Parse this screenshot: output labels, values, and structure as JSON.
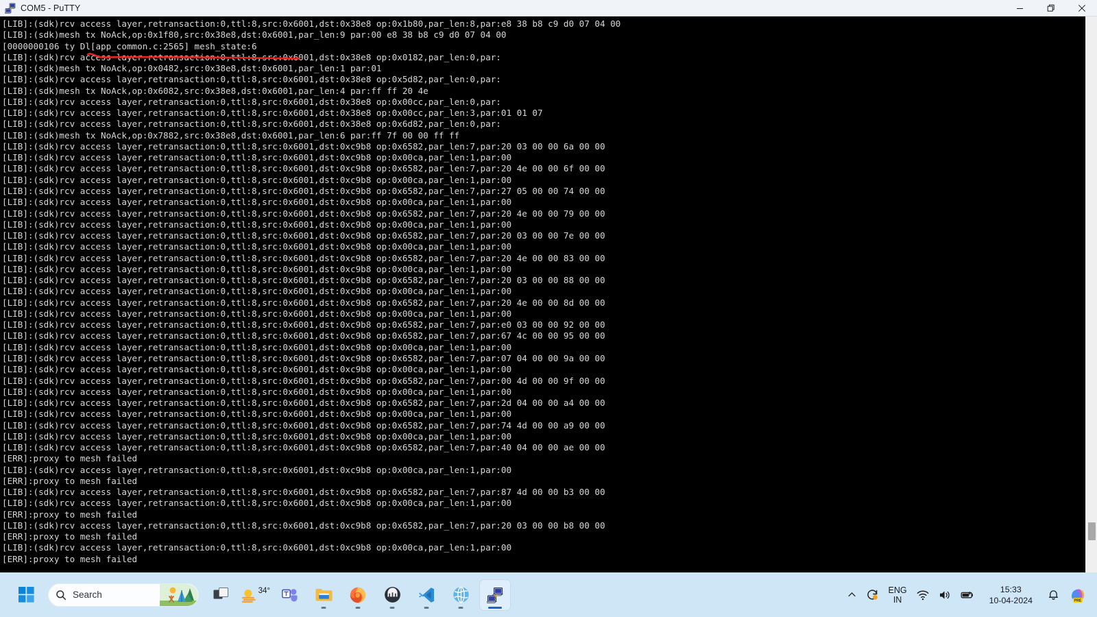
{
  "window": {
    "title": "COM5 - PuTTY",
    "icon": "putty-network-icon",
    "controls": {
      "minimize": "minimize-button",
      "restore": "restore-button",
      "close": "close-button"
    }
  },
  "terminal": {
    "background": "#000000",
    "foreground": "#d8d8d8",
    "lines": [
      "[LIB]:(sdk)rcv access layer,retransaction:0,ttl:8,src:0x6001,dst:0x38e8 op:0x1b80,par_len:8,par:e8 38 b8 c9 d0 07 04 00",
      "[LIB]:(sdk)mesh tx NoAck,op:0x1f80,src:0x38e8,dst:0x6001,par_len:9 par:00 e8 38 b8 c9 d0 07 04 00",
      "[0000000106 ty Dl[app_common.c:2565] mesh_state:6",
      "[LIB]:(sdk)rcv access layer,retransaction:0,ttl:8,src:0x6001,dst:0x38e8 op:0x0182,par_len:0,par:",
      "[LIB]:(sdk)mesh tx NoAck,op:0x0482,src:0x38e8,dst:0x6001,par_len:1 par:01",
      "[LIB]:(sdk)rcv access layer,retransaction:0,ttl:8,src:0x6001,dst:0x38e8 op:0x5d82,par_len:0,par:",
      "[LIB]:(sdk)mesh tx NoAck,op:0x6082,src:0x38e8,dst:0x6001,par_len:4 par:ff ff 20 4e",
      "[LIB]:(sdk)rcv access layer,retransaction:0,ttl:8,src:0x6001,dst:0x38e8 op:0x00cc,par_len:0,par:",
      "[LIB]:(sdk)rcv access layer,retransaction:0,ttl:8,src:0x6001,dst:0x38e8 op:0x00cc,par_len:3,par:01 01 07",
      "[LIB]:(sdk)rcv access layer,retransaction:0,ttl:8,src:0x6001,dst:0x38e8 op:0x6d82,par_len:0,par:",
      "[LIB]:(sdk)mesh tx NoAck,op:0x7882,src:0x38e8,dst:0x6001,par_len:6 par:ff 7f 00 00 ff ff",
      "[LIB]:(sdk)rcv access layer,retransaction:0,ttl:8,src:0x6001,dst:0xc9b8 op:0x6582,par_len:7,par:20 03 00 00 6a 00 00",
      "[LIB]:(sdk)rcv access layer,retransaction:0,ttl:8,src:0x6001,dst:0xc9b8 op:0x00ca,par_len:1,par:00",
      "[LIB]:(sdk)rcv access layer,retransaction:0,ttl:8,src:0x6001,dst:0xc9b8 op:0x6582,par_len:7,par:20 4e 00 00 6f 00 00",
      "[LIB]:(sdk)rcv access layer,retransaction:0,ttl:8,src:0x6001,dst:0xc9b8 op:0x00ca,par_len:1,par:00",
      "[LIB]:(sdk)rcv access layer,retransaction:0,ttl:8,src:0x6001,dst:0xc9b8 op:0x6582,par_len:7,par:27 05 00 00 74 00 00",
      "[LIB]:(sdk)rcv access layer,retransaction:0,ttl:8,src:0x6001,dst:0xc9b8 op:0x00ca,par_len:1,par:00",
      "[LIB]:(sdk)rcv access layer,retransaction:0,ttl:8,src:0x6001,dst:0xc9b8 op:0x6582,par_len:7,par:20 4e 00 00 79 00 00",
      "[LIB]:(sdk)rcv access layer,retransaction:0,ttl:8,src:0x6001,dst:0xc9b8 op:0x00ca,par_len:1,par:00",
      "[LIB]:(sdk)rcv access layer,retransaction:0,ttl:8,src:0x6001,dst:0xc9b8 op:0x6582,par_len:7,par:20 03 00 00 7e 00 00",
      "[LIB]:(sdk)rcv access layer,retransaction:0,ttl:8,src:0x6001,dst:0xc9b8 op:0x00ca,par_len:1,par:00",
      "[LIB]:(sdk)rcv access layer,retransaction:0,ttl:8,src:0x6001,dst:0xc9b8 op:0x6582,par_len:7,par:20 4e 00 00 83 00 00",
      "[LIB]:(sdk)rcv access layer,retransaction:0,ttl:8,src:0x6001,dst:0xc9b8 op:0x00ca,par_len:1,par:00",
      "[LIB]:(sdk)rcv access layer,retransaction:0,ttl:8,src:0x6001,dst:0xc9b8 op:0x6582,par_len:7,par:20 03 00 00 88 00 00",
      "[LIB]:(sdk)rcv access layer,retransaction:0,ttl:8,src:0x6001,dst:0xc9b8 op:0x00ca,par_len:1,par:00",
      "[LIB]:(sdk)rcv access layer,retransaction:0,ttl:8,src:0x6001,dst:0xc9b8 op:0x6582,par_len:7,par:20 4e 00 00 8d 00 00",
      "[LIB]:(sdk)rcv access layer,retransaction:0,ttl:8,src:0x6001,dst:0xc9b8 op:0x00ca,par_len:1,par:00",
      "[LIB]:(sdk)rcv access layer,retransaction:0,ttl:8,src:0x6001,dst:0xc9b8 op:0x6582,par_len:7,par:e0 03 00 00 92 00 00",
      "[LIB]:(sdk)rcv access layer,retransaction:0,ttl:8,src:0x6001,dst:0xc9b8 op:0x6582,par_len:7,par:67 4c 00 00 95 00 00",
      "[LIB]:(sdk)rcv access layer,retransaction:0,ttl:8,src:0x6001,dst:0xc9b8 op:0x00ca,par_len:1,par:00",
      "[LIB]:(sdk)rcv access layer,retransaction:0,ttl:8,src:0x6001,dst:0xc9b8 op:0x6582,par_len:7,par:07 04 00 00 9a 00 00",
      "[LIB]:(sdk)rcv access layer,retransaction:0,ttl:8,src:0x6001,dst:0xc9b8 op:0x00ca,par_len:1,par:00",
      "[LIB]:(sdk)rcv access layer,retransaction:0,ttl:8,src:0x6001,dst:0xc9b8 op:0x6582,par_len:7,par:00 4d 00 00 9f 00 00",
      "[LIB]:(sdk)rcv access layer,retransaction:0,ttl:8,src:0x6001,dst:0xc9b8 op:0x00ca,par_len:1,par:00",
      "[LIB]:(sdk)rcv access layer,retransaction:0,ttl:8,src:0x6001,dst:0xc9b8 op:0x6582,par_len:7,par:2d 04 00 00 a4 00 00",
      "[LIB]:(sdk)rcv access layer,retransaction:0,ttl:8,src:0x6001,dst:0xc9b8 op:0x00ca,par_len:1,par:00",
      "[LIB]:(sdk)rcv access layer,retransaction:0,ttl:8,src:0x6001,dst:0xc9b8 op:0x6582,par_len:7,par:74 4d 00 00 a9 00 00",
      "[LIB]:(sdk)rcv access layer,retransaction:0,ttl:8,src:0x6001,dst:0xc9b8 op:0x00ca,par_len:1,par:00",
      "[LIB]:(sdk)rcv access layer,retransaction:0,ttl:8,src:0x6001,dst:0xc9b8 op:0x6582,par_len:7,par:40 04 00 00 ae 00 00",
      "[ERR]:proxy to mesh failed",
      "[LIB]:(sdk)rcv access layer,retransaction:0,ttl:8,src:0x6001,dst:0xc9b8 op:0x00ca,par_len:1,par:00",
      "[ERR]:proxy to mesh failed",
      "[LIB]:(sdk)rcv access layer,retransaction:0,ttl:8,src:0x6001,dst:0xc9b8 op:0x6582,par_len:7,par:87 4d 00 00 b3 00 00",
      "[LIB]:(sdk)rcv access layer,retransaction:0,ttl:8,src:0x6001,dst:0xc9b8 op:0x00ca,par_len:1,par:00",
      "[ERR]:proxy to mesh failed",
      "[LIB]:(sdk)rcv access layer,retransaction:0,ttl:8,src:0x6001,dst:0xc9b8 op:0x6582,par_len:7,par:20 03 00 00 b8 00 00",
      "[ERR]:proxy to mesh failed",
      "[LIB]:(sdk)rcv access layer,retransaction:0,ttl:8,src:0x6001,dst:0xc9b8 op:0x00ca,par_len:1,par:00",
      "[ERR]:proxy to mesh failed"
    ]
  },
  "annotation": {
    "type": "hand-drawn-underline",
    "color": "#e8261f",
    "target_line_index": 2,
    "target_text": "[app_common.c:2565] mesh_state:6"
  },
  "taskbar": {
    "background": "#cfe6f7",
    "start": {
      "name": "start-button",
      "label": "Start"
    },
    "search": {
      "placeholder": "Search",
      "icon": "search-icon"
    },
    "items": [
      {
        "name": "task-view-button",
        "label": "Task View",
        "icon": "task-view-icon",
        "active": false,
        "running": false
      },
      {
        "name": "weather-widget",
        "label": "34°",
        "icon": "weather-sun-icon",
        "active": false,
        "running": false
      },
      {
        "name": "microsoft-teams",
        "label": "Microsoft Teams",
        "icon": "teams-icon",
        "active": false,
        "running": false
      },
      {
        "name": "file-explorer",
        "label": "File Explorer",
        "icon": "folder-icon",
        "active": false,
        "running": true
      },
      {
        "name": "firefox",
        "label": "Firefox",
        "icon": "firefox-icon",
        "active": false,
        "running": true
      },
      {
        "name": "app-dark-circle",
        "label": "App",
        "icon": "dark-circle-icon",
        "active": false,
        "running": true
      },
      {
        "name": "visual-studio-code",
        "label": "Visual Studio Code",
        "icon": "vscode-icon",
        "active": false,
        "running": true
      },
      {
        "name": "globe-app",
        "label": "App",
        "icon": "globe-icon",
        "active": false,
        "running": true
      },
      {
        "name": "putty",
        "label": "PuTTY",
        "icon": "putty-network-icon",
        "active": true,
        "running": true
      }
    ],
    "tray": {
      "overflow": "show-hidden-icons-chevron",
      "update": "windows-update-icon",
      "language": {
        "line1": "ENG",
        "line2": "IN"
      },
      "wifi": "wifi-icon",
      "volume": "speaker-icon",
      "battery": "battery-icon",
      "clock": {
        "time": "15:33",
        "date": "10-04-2024"
      },
      "notifications": "bell-icon",
      "copilot": {
        "icon": "copilot-icon",
        "badge": "PRE"
      }
    }
  }
}
